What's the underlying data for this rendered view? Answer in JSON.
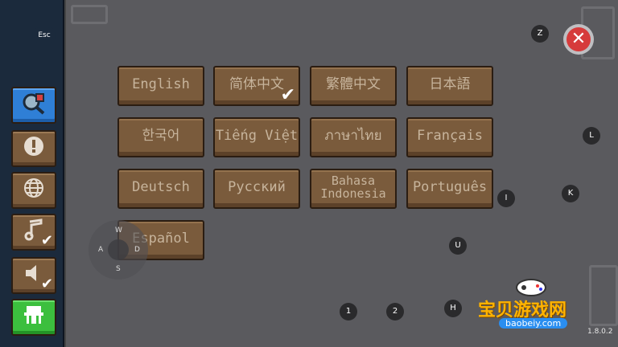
{
  "hotkeys": {
    "esc": "Esc",
    "close": "Z",
    "l": "L",
    "k": "K",
    "i": "I",
    "u": "U",
    "h": "H",
    "one": "1",
    "two": "2"
  },
  "joystick": {
    "w": "W",
    "a": "A",
    "s": "S",
    "d": "D"
  },
  "sidebar": {
    "buttons": [
      {
        "icon": "magnifier-icon",
        "active": true
      },
      {
        "icon": "exclamation-icon"
      },
      {
        "icon": "globe-icon"
      },
      {
        "icon": "music-note-icon",
        "checked": true
      },
      {
        "icon": "speaker-icon",
        "checked": true
      },
      {
        "icon": "shop-icon",
        "color": "green"
      }
    ]
  },
  "languages": [
    {
      "label": "English"
    },
    {
      "label": "简体中文",
      "selected": true
    },
    {
      "label": "繁體中文"
    },
    {
      "label": "日本語"
    },
    {
      "label": "한국어"
    },
    {
      "label": "Tiếng Việt"
    },
    {
      "label": "ภาษาไทย"
    },
    {
      "label": "Français"
    },
    {
      "label": "Deutsch"
    },
    {
      "label": "Русский"
    },
    {
      "label": "Bahasa Indonesia"
    },
    {
      "label": "Português"
    },
    {
      "label": "Español"
    }
  ],
  "version": "1.8.0.2",
  "watermark": {
    "title": "宝贝游戏网",
    "url": "baobeiy.com"
  },
  "colors": {
    "panel": "#5a5a5e",
    "button": "#7a5b3c",
    "active": "#2f7fd6",
    "close": "#d63b3b",
    "shop": "#3cbf3e"
  }
}
